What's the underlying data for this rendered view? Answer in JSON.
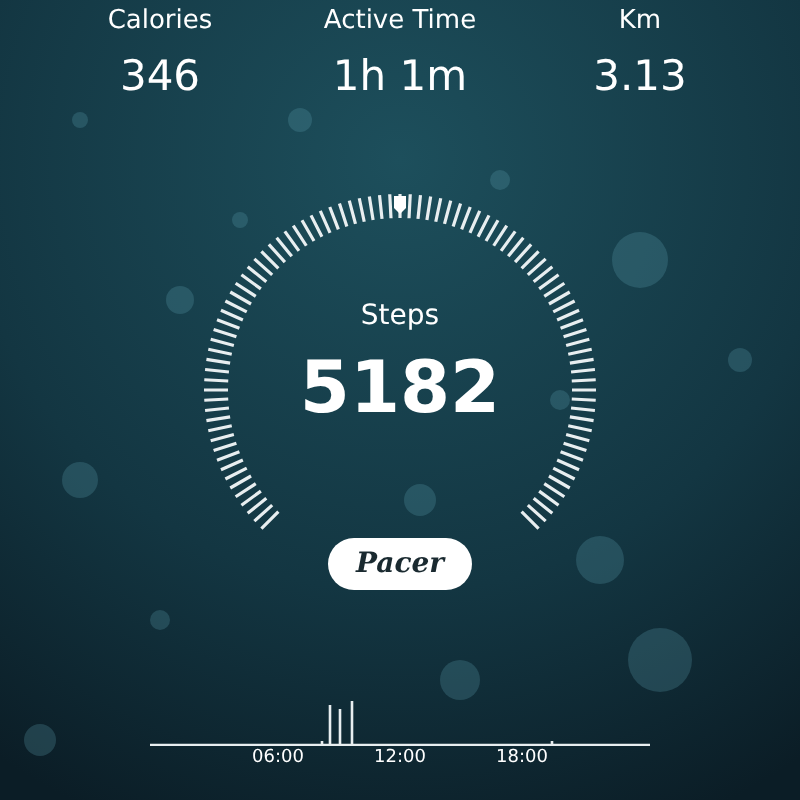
{
  "stats": [
    {
      "label": "Calories",
      "value": "346"
    },
    {
      "label": "Active Time",
      "value": "1h 1m"
    },
    {
      "label": "Km",
      "value": "3.13"
    }
  ],
  "gauge": {
    "label": "Steps",
    "value": "5182"
  },
  "logo_button": {
    "label": "Pacer"
  },
  "hourly_chart": {
    "hour_labels": [
      "06:00",
      "12:00",
      "18:00"
    ]
  }
}
